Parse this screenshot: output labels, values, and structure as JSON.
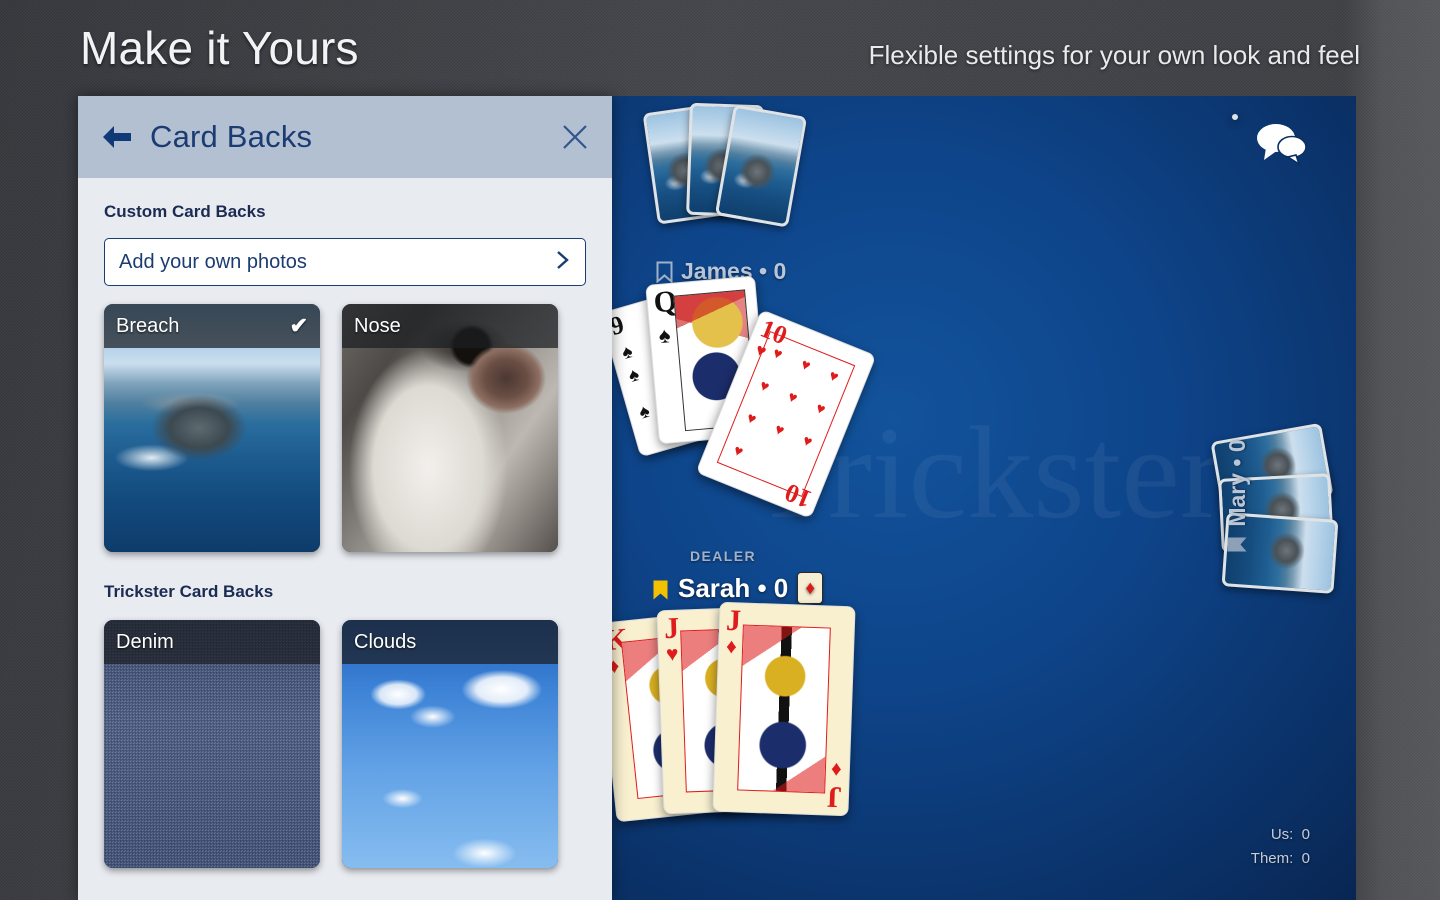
{
  "header": {
    "title": "Make it Yours",
    "subtitle": "Flexible settings for your own look and feel"
  },
  "panel": {
    "title": "Card Backs",
    "back_icon": "back-arrow-icon",
    "close_icon": "close-icon",
    "sections": [
      {
        "heading": "Custom Card Backs",
        "add_button": {
          "label": "Add your own photos",
          "chevron": "chevron-right-icon"
        },
        "tiles": [
          {
            "label": "Breach",
            "selected": true,
            "check": "✔"
          },
          {
            "label": "Nose",
            "selected": false,
            "check": ""
          }
        ]
      },
      {
        "heading": "Trickster Card Backs",
        "tiles": [
          {
            "label": "Denim",
            "selected": false,
            "check": ""
          },
          {
            "label": "Clouds",
            "selected": false,
            "check": ""
          }
        ]
      }
    ]
  },
  "game": {
    "chat_icon": "chat-bubbles-icon",
    "watermark": "Trickster",
    "players": {
      "top": {
        "name": "James",
        "score": "0",
        "label": "James • 0",
        "marker": "bookmark-outline-icon"
      },
      "right": {
        "name": "Mary",
        "score": "0",
        "label": "Mary • 0",
        "marker": "bookmark-filled-icon"
      },
      "bottom": {
        "name": "Sarah",
        "score": "0",
        "label": "Sarah • 0",
        "dealer_label": "DEALER",
        "marker": "bookmark-gold-icon",
        "trump_suit": "♦"
      }
    },
    "scoreboard": {
      "us_label": "Us:",
      "us_value": "0",
      "them_label": "Them:",
      "them_value": "0"
    },
    "trick_cards": [
      {
        "rank": "Q",
        "suit": "♠",
        "color": "black"
      },
      {
        "rank": "9",
        "suit": "♠",
        "color": "black"
      },
      {
        "rank": "10",
        "suit": "♥",
        "color": "red"
      }
    ],
    "hand_cards": [
      {
        "rank": "K",
        "suit": "♦",
        "color": "red"
      },
      {
        "rank": "J",
        "suit": "♥",
        "color": "red"
      },
      {
        "rank": "J",
        "suit": "♦",
        "color": "red"
      }
    ]
  },
  "colors": {
    "page_bg": "#3c3e43",
    "panel_bg": "#e8ebf0",
    "panel_header_bg": "#b3c0d2",
    "accent_navy": "#1b3c72",
    "board_blue": "#0e4489",
    "gold": "#f2c200",
    "red_suit": "#e01b1b"
  }
}
